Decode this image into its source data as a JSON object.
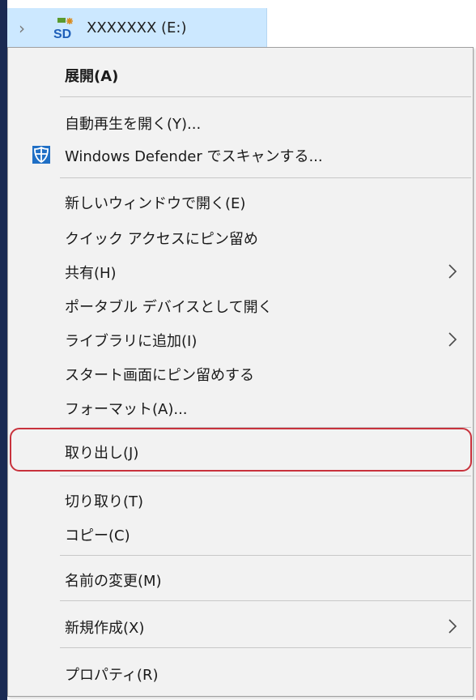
{
  "tree": {
    "drive_label": "XXXXXXX (E:)",
    "drive_icon": "sd-card-icon",
    "chevron": "›"
  },
  "menu": {
    "items": [
      {
        "label": "展開(A)",
        "bold": true
      },
      {
        "label": "自動再生を開く(Y)..."
      },
      {
        "label": "Windows Defender でスキャンする...",
        "icon": "windows-defender-icon"
      },
      {
        "label": "新しいウィンドウで開く(E)"
      },
      {
        "label": "クイック アクセスにピン留め"
      },
      {
        "label": "共有(H)",
        "submenu": true
      },
      {
        "label": "ポータブル デバイスとして開く"
      },
      {
        "label": "ライブラリに追加(I)",
        "submenu": true
      },
      {
        "label": "スタート画面にピン留めする"
      },
      {
        "label": "フォーマット(A)..."
      },
      {
        "label": "取り出し(J)",
        "highlighted": true
      },
      {
        "label": "切り取り(T)"
      },
      {
        "label": "コピー(C)"
      },
      {
        "label": "名前の変更(M)"
      },
      {
        "label": "新規作成(X)",
        "submenu": true
      },
      {
        "label": "プロパティ(R)"
      }
    ]
  },
  "colors": {
    "selection": "#cce8ff",
    "menu_bg": "#f2f2f2",
    "highlight_ring": "#c8323c",
    "defender_blue": "#1f6fc5"
  }
}
